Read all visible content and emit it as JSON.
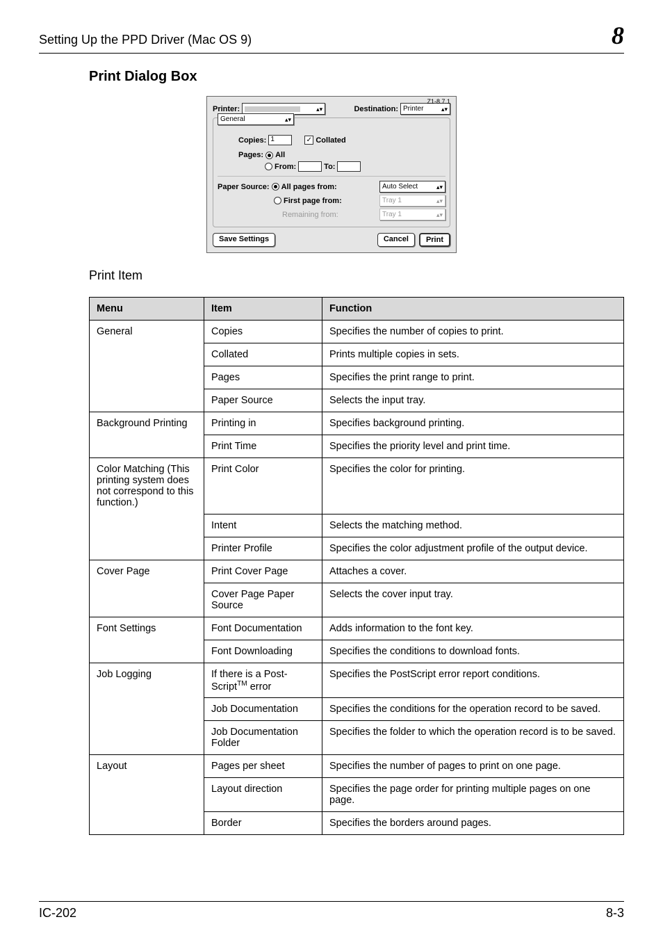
{
  "header": {
    "left": "Setting Up the PPD Driver (Mac OS 9)",
    "right": "8"
  },
  "section_title": "Print Dialog Box",
  "dialog": {
    "version": "Z1-8.7.1",
    "printer_label": "Printer:",
    "destination_label": "Destination:",
    "destination_value": "Printer",
    "tab_value": "General",
    "copies_label": "Copies:",
    "copies_value": "1",
    "collated_label": "Collated",
    "pages_label": "Pages:",
    "pages_all": "All",
    "pages_from": "From:",
    "pages_to": "To:",
    "papersource_label": "Paper Source:",
    "ps_allpages": "All pages from:",
    "ps_allpages_value": "Auto Select",
    "ps_firstpage": "First page from:",
    "ps_firstpage_value": "Tray 1",
    "ps_remaining": "Remaining from:",
    "ps_remaining_value": "Tray 1",
    "save_settings": "Save Settings",
    "cancel": "Cancel",
    "print": "Print"
  },
  "subheading": "Print Item",
  "table": {
    "head": {
      "menu": "Menu",
      "item": "Item",
      "function": "Function"
    },
    "rows": [
      {
        "menu": "General",
        "item": "Copies",
        "func": "Specifies the number of copies to print.",
        "m_span": 4
      },
      {
        "item": "Collated",
        "func": "Prints multiple copies in sets."
      },
      {
        "item": "Pages",
        "func": "Specifies the print range to print."
      },
      {
        "item": "Paper Source",
        "func": "Selects the input tray."
      },
      {
        "menu": "Background Printing",
        "item": "Printing in",
        "func": "Specifies background printing.",
        "m_span": 2
      },
      {
        "item": "Print Time",
        "func": "Specifies the priority level and print time."
      },
      {
        "menu": "Color Matching\n(This printing system does not correspond to this function.)",
        "item": "Print Color",
        "func": "Specifies the color for printing.",
        "m_span": 3
      },
      {
        "item": "Intent",
        "func": "Selects the matching method."
      },
      {
        "item": "Printer Profile",
        "func": "Specifies the color adjustment profile of the output device."
      },
      {
        "menu": "Cover Page",
        "item": "Print Cover Page",
        "func": "Attaches a cover.",
        "m_span": 2
      },
      {
        "item": "Cover Page Paper Source",
        "func": "Selects the cover input tray."
      },
      {
        "menu": "Font Settings",
        "item": "Font Documentation",
        "func": "Adds information to the font key.",
        "m_span": 2
      },
      {
        "item": "Font Downloading",
        "func": "Specifies the conditions to download fonts."
      },
      {
        "menu": "Job Logging",
        "item": "If there is a PostScript™ error",
        "func": "Specifies the PostScript error report conditions.",
        "m_span": 3,
        "tm": true
      },
      {
        "item": "Job Documentation",
        "func": "Specifies the conditions for the operation record to be saved."
      },
      {
        "item": "Job Documentation Folder",
        "func": "Specifies the folder to which the operation record is to be saved."
      },
      {
        "menu": "Layout",
        "item": "Pages per sheet",
        "func": "Specifies the number of pages to print on one page.",
        "m_span": 3
      },
      {
        "item": "Layout direction",
        "func": "Specifies the page order for printing multiple pages on one page."
      },
      {
        "item": "Border",
        "func": "Specifies the borders around pages."
      }
    ]
  },
  "footer": {
    "left": "IC-202",
    "right": "8-3"
  }
}
